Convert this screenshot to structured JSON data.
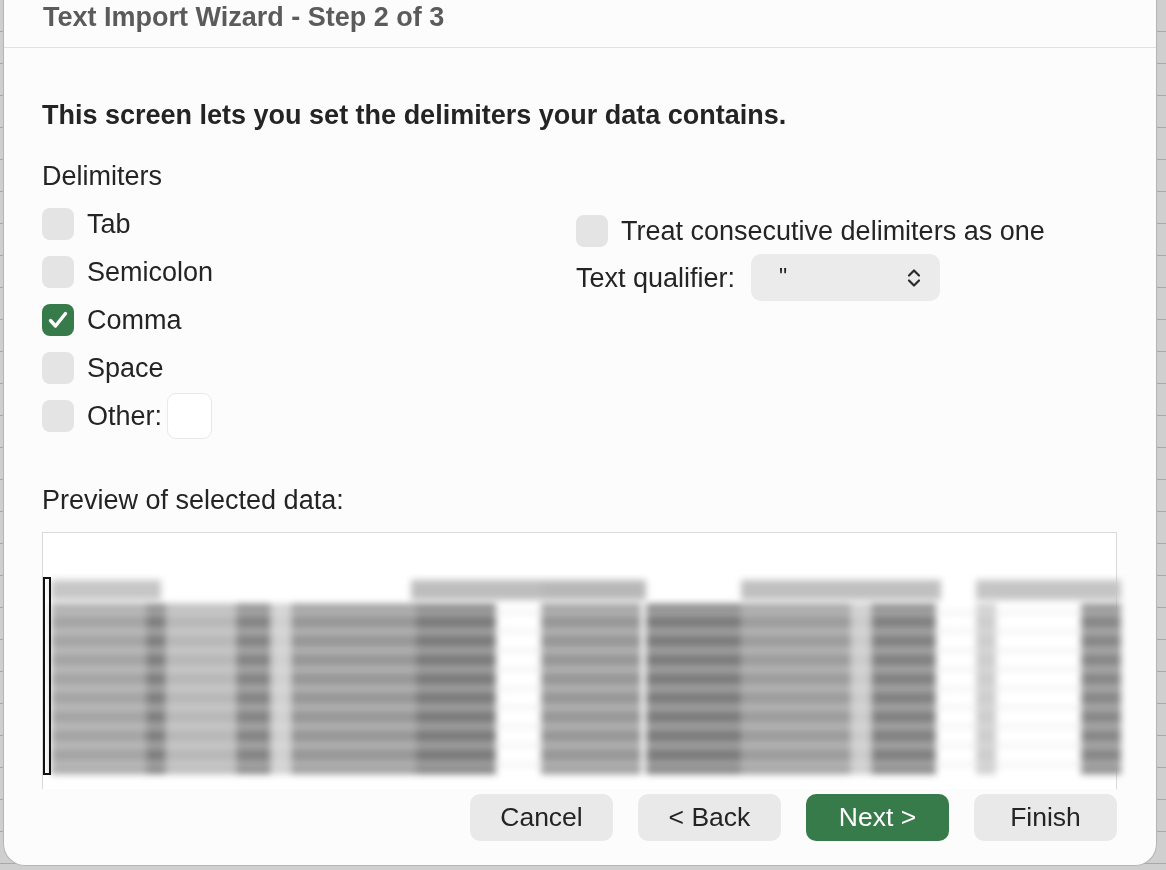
{
  "window": {
    "title": "Text Import Wizard - Step 2 of 3"
  },
  "instruction": "This screen lets you set the delimiters your data contains.",
  "delimiters": {
    "heading": "Delimiters",
    "options": [
      {
        "label": "Tab",
        "checked": false,
        "kind": "plain"
      },
      {
        "label": "Semicolon",
        "checked": false,
        "kind": "plain"
      },
      {
        "label": "Comma",
        "checked": true,
        "kind": "plain"
      },
      {
        "label": "Space",
        "checked": false,
        "kind": "plain"
      },
      {
        "label": "Other:",
        "checked": false,
        "kind": "with_field"
      }
    ]
  },
  "consecutive": {
    "label": "Treat consecutive delimiters as one",
    "checked": false
  },
  "text_qualifier": {
    "label": "Text qualifier:",
    "value": "\""
  },
  "preview": {
    "label": "Preview of selected data:"
  },
  "buttons": [
    {
      "label": "Cancel",
      "primary": false
    },
    {
      "label": "< Back",
      "primary": false
    },
    {
      "label": "Next >",
      "primary": true
    },
    {
      "label": "Finish",
      "primary": false
    }
  ]
}
